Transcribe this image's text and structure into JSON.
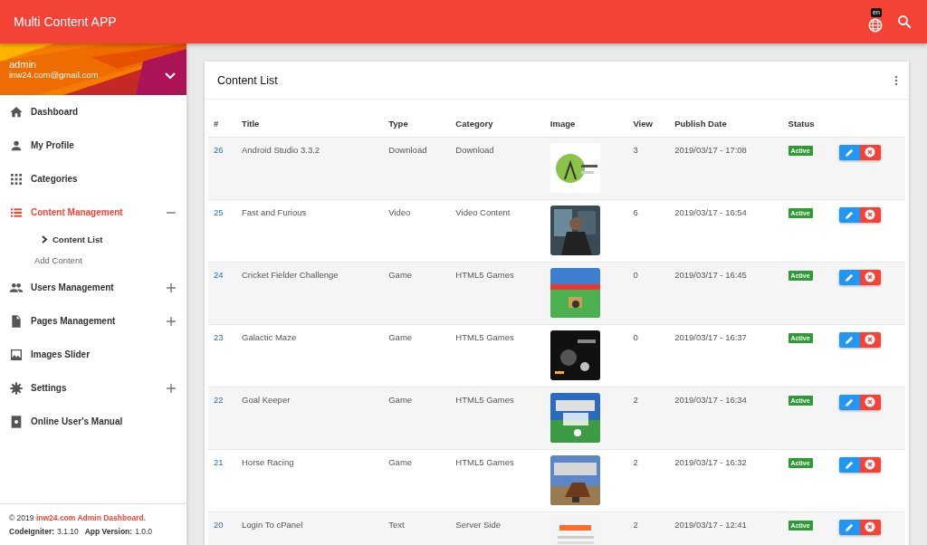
{
  "app_bar": {
    "title": "Multi Content APP",
    "language_badge": "en"
  },
  "sidebar": {
    "user": {
      "name": "admin",
      "email": "inw24.com@gmail.com"
    },
    "items": [
      {
        "label": "Dashboard",
        "selected": false
      },
      {
        "label": "My Profile",
        "selected": false
      },
      {
        "label": "Categories",
        "selected": false
      },
      {
        "label": "Content Management",
        "selected": true,
        "expanded": true,
        "children": [
          {
            "label": "Content List",
            "selected": true
          },
          {
            "label": "Add Content",
            "selected": false
          }
        ]
      },
      {
        "label": "Users Management",
        "selected": false,
        "expanded": false
      },
      {
        "label": "Pages Management",
        "selected": false,
        "expanded": false
      },
      {
        "label": "Images Slider",
        "selected": false
      },
      {
        "label": "Settings",
        "selected": false,
        "expanded": false
      },
      {
        "label": "Online User's Manual",
        "selected": false
      }
    ],
    "footer": {
      "copyright": "© 2019",
      "site": "inw24.com Admin Dashboard.",
      "framework_label": "CodeIgniter:",
      "framework_version": "3.1.10",
      "version_label": "App Version:",
      "version": "1.0.0"
    }
  },
  "card": {
    "title": "Content List",
    "table": {
      "columns": [
        "#",
        "Title",
        "Type",
        "Category",
        "Image",
        "View",
        "Publish Date",
        "Status"
      ],
      "rows": [
        {
          "id": "26",
          "title": "Android Studio 3.3.2",
          "type": "Download",
          "category": "Download",
          "view": "3",
          "date": "2019/03/17 - 17:08",
          "status": "Active"
        },
        {
          "id": "25",
          "title": "Fast and Furious",
          "type": "Video",
          "category": "Video Content",
          "view": "6",
          "date": "2019/03/17 - 16:54",
          "status": "Active"
        },
        {
          "id": "24",
          "title": "Cricket Fielder Challenge",
          "type": "Game",
          "category": "HTML5 Games",
          "view": "0",
          "date": "2019/03/17 - 16:45",
          "status": "Active"
        },
        {
          "id": "23",
          "title": "Galactic Maze",
          "type": "Game",
          "category": "HTML5 Games",
          "view": "0",
          "date": "2019/03/17 - 16:37",
          "status": "Active"
        },
        {
          "id": "22",
          "title": "Goal Keeper",
          "type": "Game",
          "category": "HTML5 Games",
          "view": "2",
          "date": "2019/03/17 - 16:34",
          "status": "Active"
        },
        {
          "id": "21",
          "title": "Horse Racing",
          "type": "Game",
          "category": "HTML5 Games",
          "view": "2",
          "date": "2019/03/17 - 16:32",
          "status": "Active"
        },
        {
          "id": "20",
          "title": "Login To cPanel",
          "type": "Text",
          "category": "Server Side",
          "view": "2",
          "date": "2019/03/17 - 12:41",
          "status": "Active"
        }
      ]
    }
  }
}
